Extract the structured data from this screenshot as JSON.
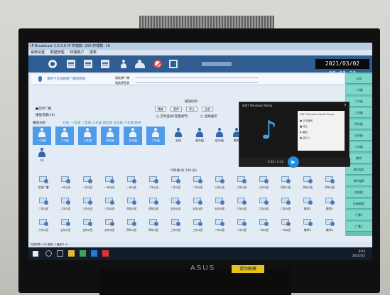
{
  "window": {
    "title": "IP Broadcast 1.0.0.6  IP 终端数: 200  终端数: 16"
  },
  "menu": [
    "系统设置",
    "数据管理",
    "终端账户",
    "报表"
  ],
  "toolbar": {
    "icons": [
      "gear-icon",
      "document-icon",
      "document-icon",
      "document-icon",
      "person-icon",
      "group-icon",
      "stop-icon",
      "exit-icon"
    ],
    "clock": "2021/03/02 08:03:29"
  },
  "sidebar": {
    "items": [
      "全部",
      "一年级",
      "二年级",
      "三年级",
      "四年级",
      "五年级",
      "六年级",
      "教师",
      "教学楼A",
      "教学楼B",
      "综合楼",
      "阶梯教室",
      "广播1",
      "广播2"
    ],
    "accent_color": "#62c6b7"
  },
  "info": {
    "notice": "请将下方选择要广播的终端",
    "line_a": "请选择广播",
    "line_b": "请选择音源"
  },
  "controls": {
    "section_title": "播放控制",
    "broadcast_mode": "●实时广播",
    "volume_label": "播放音量(10)",
    "buttons": [
      "播放",
      "暂停",
      "停止",
      "全部"
    ],
    "check_a": "□ 实时监听(音量调节)",
    "check_b": "□ 选择循环"
  },
  "groups": {
    "label": "播放分区:",
    "hint": "分组: 一年级 二年级 三年级 四年级 五年级 六年级 教师",
    "tiles": [
      {
        "label": "一年级",
        "selected": true
      },
      {
        "label": "二年级",
        "selected": true
      },
      {
        "label": "三年级",
        "selected": true
      },
      {
        "label": "四年级",
        "selected": true
      },
      {
        "label": "五年级",
        "selected": true
      },
      {
        "label": "六年级",
        "selected": true
      },
      {
        "label": "全校",
        "selected": false
      },
      {
        "label": "高年级",
        "selected": false
      },
      {
        "label": "低年级",
        "selected": false
      },
      {
        "label": "教师",
        "selected": false
      },
      {
        "label": "16",
        "selected": false
      }
    ]
  },
  "video": {
    "title": "IGNT Windows Media",
    "media_rows": [
      "IGNT Windows Media Player",
      "● 正在播放",
      "■ 停止",
      "▶ 播放",
      "◼ 曲目 1"
    ],
    "time": "0:00 / 3:14",
    "play_glyph": "▶"
  },
  "terminals": {
    "title": "IP终端(共  200  台)",
    "labels": [
      "学校广播",
      "一年1班",
      "一年2班",
      "一年3班",
      "一年4班",
      "二年1班",
      "二年2班",
      "二年3班",
      "三年1班",
      "三年2班",
      "三年3班",
      "四年1班",
      "四年2班",
      "四年3班",
      "二年1班",
      "二年2班",
      "三年1班",
      "三年2班",
      "四年1班",
      "四年2班",
      "五年1班",
      "五年2班",
      "五年3班",
      "六年1班",
      "六年2班",
      "六年3班",
      "教师1",
      "教师2",
      "六年1班",
      "五年1班",
      "五年2班",
      "五年3班",
      "四年3班",
      "四年4班",
      "三年3班",
      "三年4班",
      "二年3班",
      "二年4班",
      "一年5班",
      "一年6班",
      "教师3",
      "教师4"
    ]
  },
  "status": {
    "text": "在线终端: 200    离线: 0    播放中: 6",
    "tray_time": "8:03",
    "tray_date": "2021/3/2"
  },
  "monitor": {
    "brand": "ASUS",
    "sticker": "请勿触摸"
  }
}
